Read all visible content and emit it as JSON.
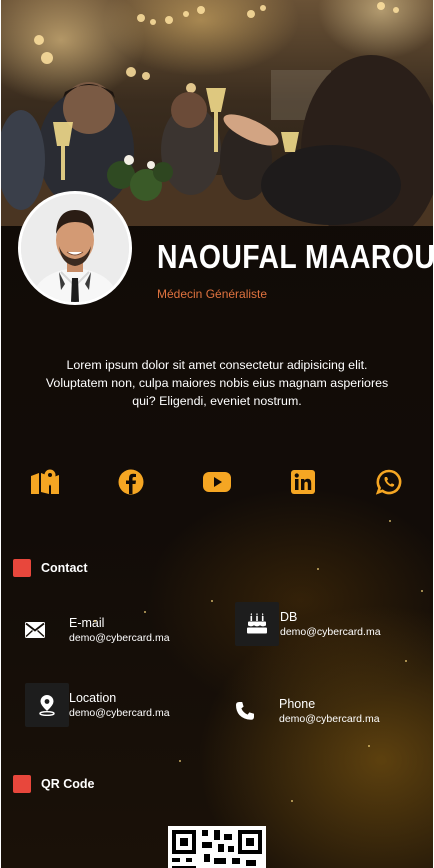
{
  "profile": {
    "name": "NAOUFAL MAAROUF",
    "title": "Médecin Généraliste",
    "bio": "Lorem ipsum dolor sit amet consectetur adipisicing elit. Voluptatem non, culpa maiores nobis eius magnam asperiores qui? Eligendi, eveniet nostrum."
  },
  "socials": [
    {
      "icon": "map-icon"
    },
    {
      "icon": "facebook-icon"
    },
    {
      "icon": "youtube-icon"
    },
    {
      "icon": "linkedin-icon"
    },
    {
      "icon": "whatsapp-icon"
    }
  ],
  "contact": {
    "heading": "Contact",
    "items": [
      {
        "label": "E-mail",
        "value": "demo@cybercard.ma",
        "icon": "envelope-icon"
      },
      {
        "label": "DB",
        "value": "demo@cybercard.ma",
        "icon": "birthday-cake-icon"
      },
      {
        "label": "Location",
        "value": "demo@cybercard.ma",
        "icon": "location-pin-icon"
      },
      {
        "label": "Phone",
        "value": "demo@cybercard.ma",
        "icon": "phone-icon"
      }
    ]
  },
  "qr": {
    "heading": "QR Code"
  },
  "colors": {
    "accent": "#e8473c",
    "social": "#f5a623",
    "title": "#e0733f"
  }
}
